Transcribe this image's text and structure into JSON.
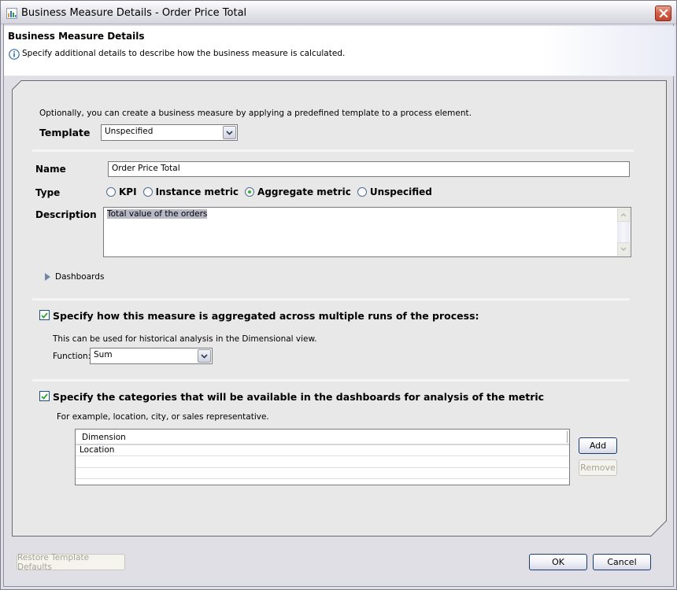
{
  "window": {
    "title": "Business Measure Details - Order Price Total",
    "close_label": "Close"
  },
  "header": {
    "title": "Business Measure Details",
    "description": "Specify additional details to describe how the business measure is calculated."
  },
  "template_section": {
    "intro": "Optionally, you can create a business measure by applying a predefined template to a process element.",
    "label": "Template",
    "selected": "Unspecified"
  },
  "form": {
    "name_label": "Name",
    "name_value": "Order Price Total",
    "type_label": "Type",
    "type_options": [
      {
        "label": "KPI",
        "selected": false
      },
      {
        "label": "Instance metric",
        "selected": false
      },
      {
        "label": "Aggregate metric",
        "selected": true
      },
      {
        "label": "Unspecified",
        "selected": false
      }
    ],
    "description_label": "Description",
    "description_value": "Total value of the orders",
    "dashboards_label": "Dashboards"
  },
  "aggregation": {
    "checked": true,
    "heading": "Specify how this measure is aggregated across multiple runs of the process:",
    "note": "This can be used for historical analysis in the Dimensional view.",
    "function_label": "Function:",
    "function_value": "Sum"
  },
  "categories": {
    "checked": true,
    "heading": "Specify the categories that will be available in the dashboards for analysis of the metric",
    "note": "For example, location, city, or sales representative.",
    "table": {
      "columns": [
        "Dimension"
      ],
      "rows": [
        [
          "Location"
        ],
        [
          ""
        ],
        [
          ""
        ],
        [
          ""
        ]
      ]
    },
    "add_label": "Add",
    "remove_label": "Remove"
  },
  "footer": {
    "restore_label": "Restore Template Defaults",
    "ok_label": "OK",
    "cancel_label": "Cancel"
  },
  "colors": {
    "panel_bg": "#e8e8e8",
    "checkmark": "#2fa72f",
    "selection_bg": "#b8b9c7",
    "close_red": "#d35a43"
  }
}
